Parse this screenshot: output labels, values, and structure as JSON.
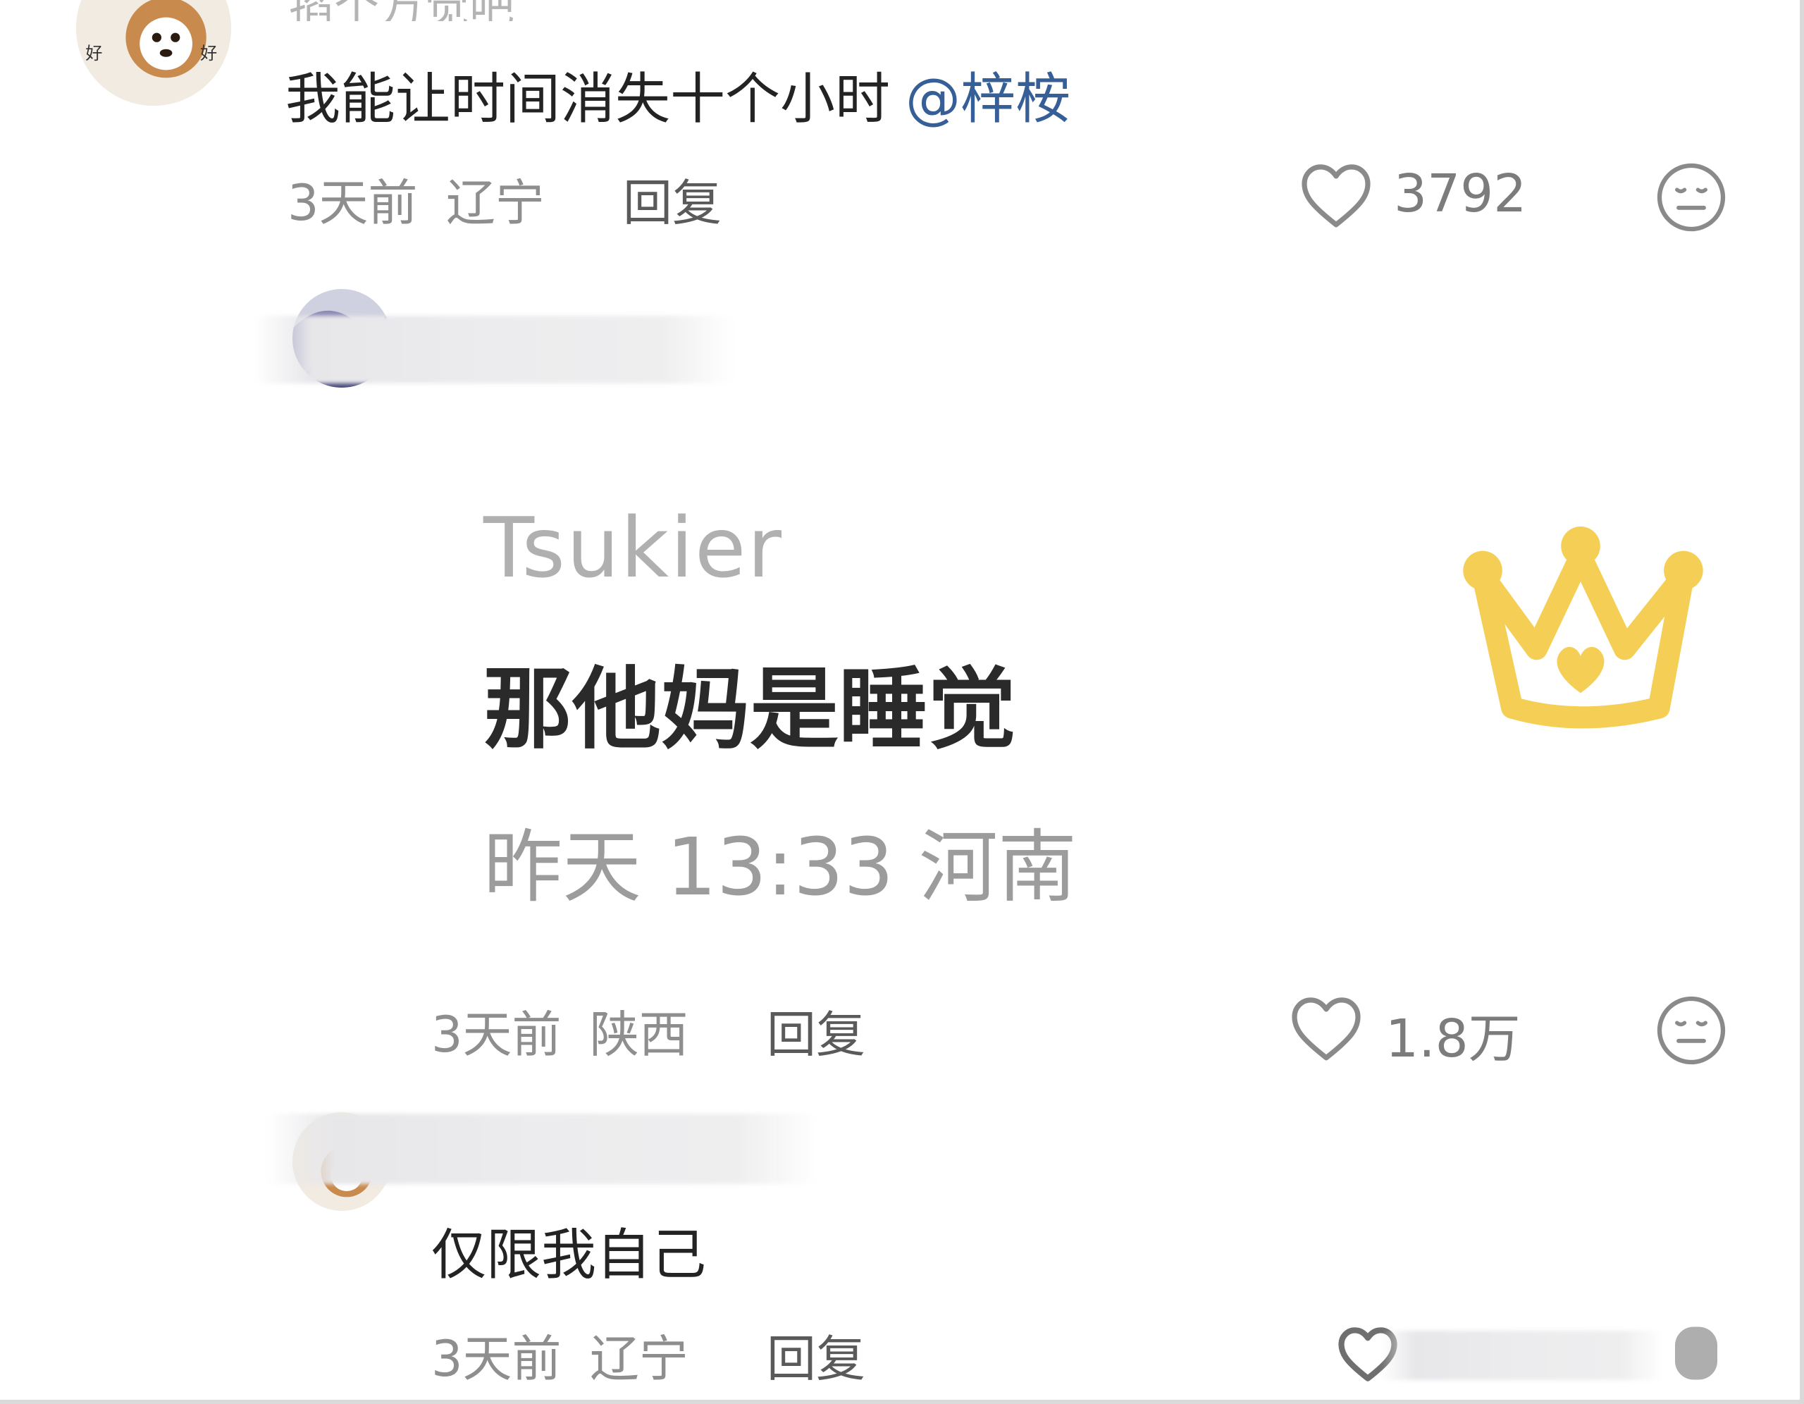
{
  "comments": [
    {
      "name_partial": "掐个万觉吧",
      "text": "我能让时间消失十个小时",
      "mention": "@梓桉",
      "time": "3天前",
      "region": "辽宁",
      "reply_label": "回复",
      "likes": "3792"
    },
    {
      "quote": {
        "name": "Tsukier",
        "text": "那他妈是睡觉",
        "meta": "昨天 13:33 河南"
      },
      "time": "3天前",
      "region": "陕西",
      "reply_label": "回复",
      "likes": "1.8万"
    },
    {
      "text": "仅限我自己",
      "time": "3天前",
      "region": "辽宁",
      "reply_label": "回复"
    }
  ],
  "icons": {
    "like": "heart-outline-icon",
    "dislike": "meh-face-icon",
    "badge": "crown-icon"
  },
  "colors": {
    "mention": "#355f96",
    "crown": "#f5cf55",
    "meta": "#8e8e8e"
  }
}
